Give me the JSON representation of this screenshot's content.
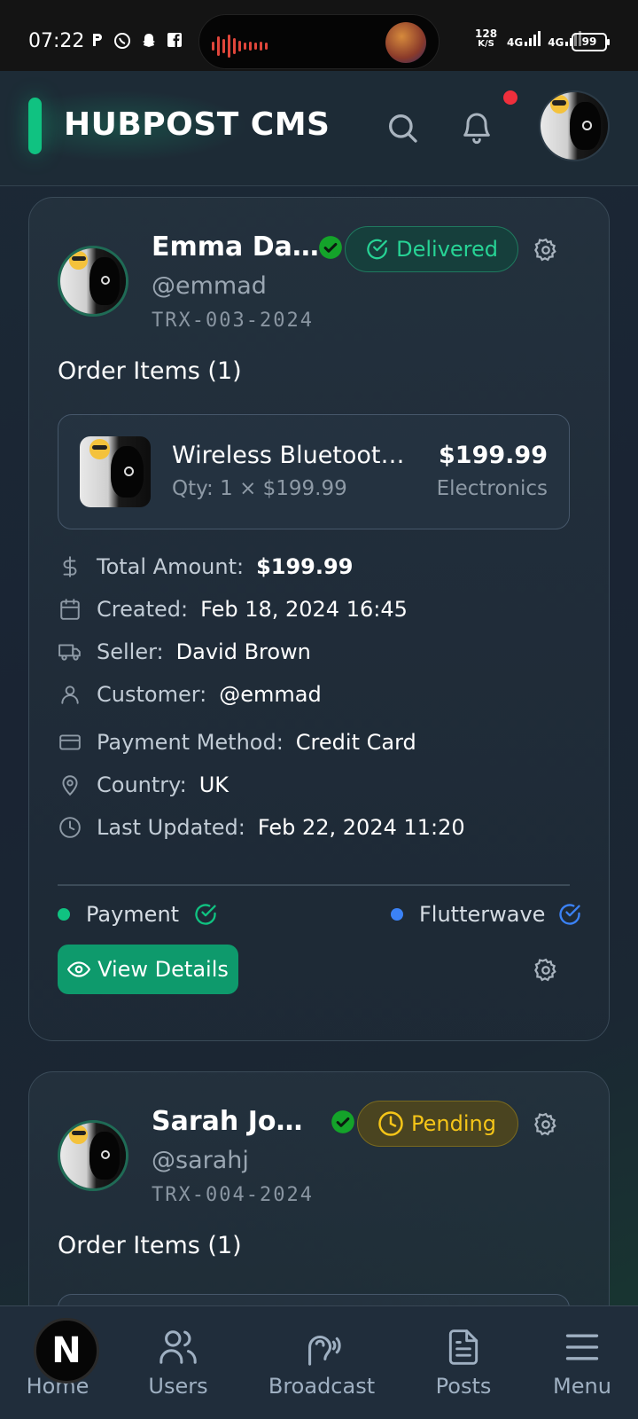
{
  "status_bar": {
    "time": "07:22",
    "app_icons": [
      "P",
      "WhatsApp",
      "Snapchat",
      "Facebook"
    ],
    "speed_value": "128",
    "speed_unit": "K/S",
    "network_1": "4G",
    "network_2": "4G",
    "battery": "99"
  },
  "header": {
    "title": "HUBPOST CMS",
    "search_icon": "search-icon",
    "notification_icon": "bell-icon",
    "accent_color": "#10c281"
  },
  "orders": [
    {
      "name": "Emma Da...",
      "handle": "@emmad",
      "trx": "TRX-003-2024",
      "status": "Delivered",
      "status_color": "#27d395",
      "items_title": "Order Items (1)",
      "item": {
        "name": "Wireless Bluetooth ...",
        "qty": "Qty: 1 × $199.99",
        "price": "$199.99",
        "category": "Electronics"
      },
      "details": [
        {
          "label": "Total Amount:",
          "value": "$199.99",
          "icon": "dollar-icon"
        },
        {
          "label": "Created:",
          "value": "Feb 18, 2024 16:45",
          "icon": "calendar-icon"
        },
        {
          "label": "Seller:",
          "value": "David Brown",
          "icon": "truck-icon"
        },
        {
          "label": "Customer:",
          "value": "@emmad",
          "icon": "user-icon"
        },
        {
          "label": "Payment Method:",
          "value": "Credit Card",
          "icon": "credit-card-icon"
        },
        {
          "label": "Country:",
          "value": "UK",
          "icon": "map-pin-icon"
        },
        {
          "label": "Last Updated:",
          "value": "Feb 22, 2024 11:20",
          "icon": "clock-icon"
        }
      ],
      "payment_label": "Payment",
      "gateway_label": "Flutterwave",
      "view_button": "View Details"
    },
    {
      "name": "Sarah John...",
      "handle": "@sarahj",
      "trx": "TRX-004-2024",
      "status": "Pending",
      "status_color": "#f5c518",
      "items_title": "Order Items (1)"
    }
  ],
  "bottom_nav": {
    "fab_letter": "N",
    "items": [
      {
        "label": "Home",
        "icon": "home-icon"
      },
      {
        "label": "Users",
        "icon": "users-icon"
      },
      {
        "label": "Broadcast",
        "icon": "broadcast-icon"
      },
      {
        "label": "Posts",
        "icon": "document-icon"
      },
      {
        "label": "Menu",
        "icon": "menu-icon"
      }
    ]
  }
}
